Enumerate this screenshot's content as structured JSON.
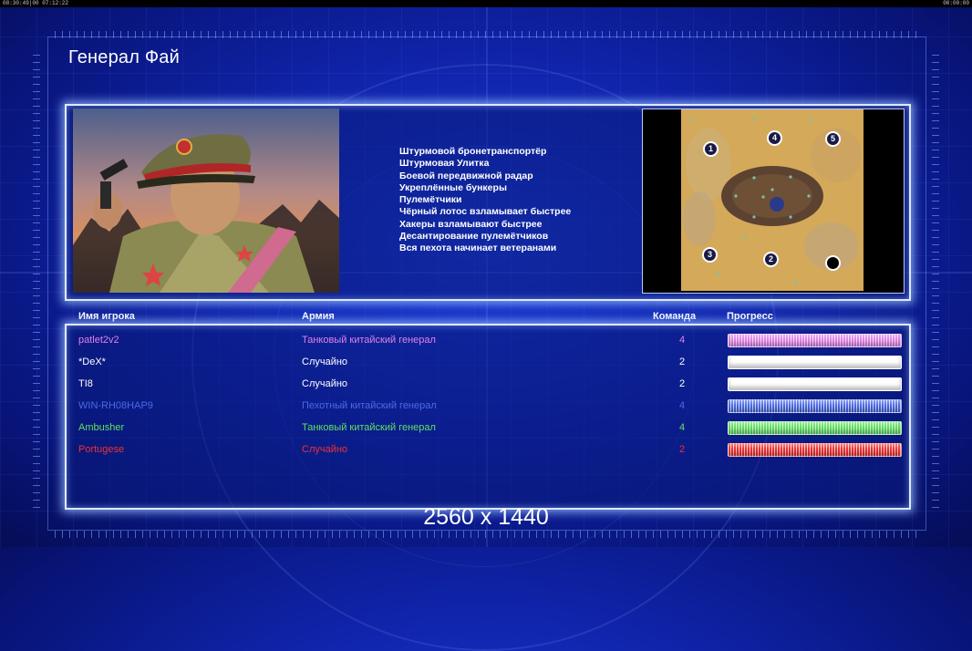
{
  "statusbar": {
    "left": "08:30:49|00 07:12:22",
    "right": "00:00:00"
  },
  "title": "Генерал Фай",
  "portrait": {
    "description": "general-portrait"
  },
  "features": [
    "Штурмовой бронетранспортёр",
    "Штурмовая Улитка",
    "Боевой передвижной радар",
    "Укреплённые бункеры",
    "Пулемётчики",
    "Чёрный лотос взламывает быстрее",
    "Хакеры взламывают быстрее",
    "Десантирование пулемётчиков",
    "Вся пехота начинает ветеранами"
  ],
  "map": {
    "start_positions": [
      "1",
      "4",
      "5",
      "3",
      "2",
      ""
    ]
  },
  "table": {
    "headers": {
      "player": "Имя игрока",
      "army": "Армия",
      "team": "Команда",
      "progress": "Прогресс"
    },
    "rows": [
      {
        "name": "patlet2v2",
        "army": "Танковый китайский генерал",
        "team": "4",
        "color": "#e080e8",
        "progress": 1.0
      },
      {
        "name": "*DeX*",
        "army": "Случайно",
        "team": "2",
        "color": "#ffffff",
        "progress": 1.0
      },
      {
        "name": "TI8",
        "army": "Случайно",
        "team": "2",
        "color": "#ffffff",
        "progress": 1.0
      },
      {
        "name": "WIN-RH08HAP9",
        "army": "Пехотный китайский генерал",
        "team": "4",
        "color": "#4a6ae8",
        "progress": 1.0
      },
      {
        "name": "Ambusher",
        "army": "Танковый китайский генерал",
        "team": "4",
        "color": "#5ee05e",
        "progress": 1.0
      },
      {
        "name": "Portugese",
        "army": "Случайно",
        "team": "2",
        "color": "#f03030",
        "progress": 1.0
      }
    ]
  },
  "resolution_text": "2560 x 1440"
}
